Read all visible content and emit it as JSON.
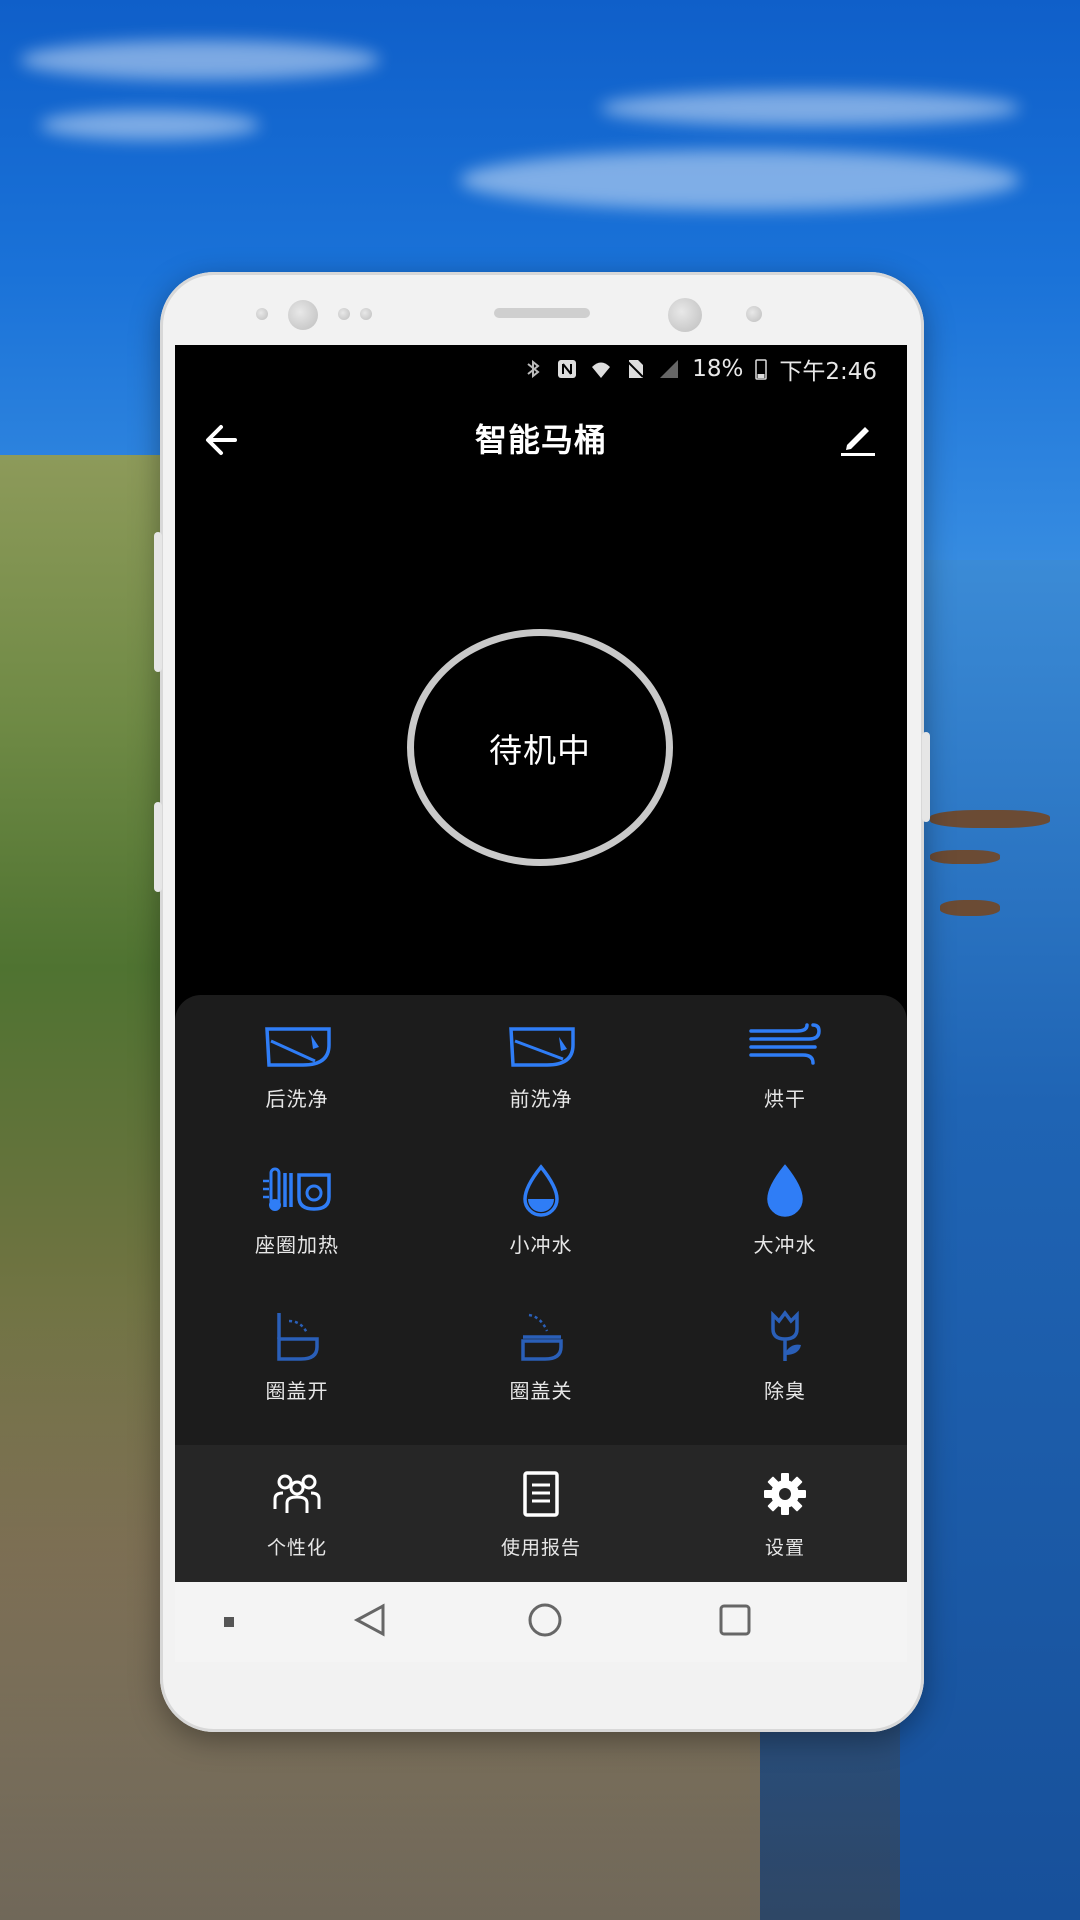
{
  "statusbar": {
    "battery": "18%",
    "time": "下午2:46"
  },
  "appbar": {
    "title": "智能马桶"
  },
  "device_status": {
    "text": "待机中"
  },
  "controls": [
    {
      "label": "后洗净",
      "icon": "rear-wash-icon"
    },
    {
      "label": "前洗净",
      "icon": "front-wash-icon"
    },
    {
      "label": "烘干",
      "icon": "dry-wind-icon"
    },
    {
      "label": "座圈加热",
      "icon": "seat-heating-icon"
    },
    {
      "label": "小冲水",
      "icon": "small-flush-icon"
    },
    {
      "label": "大冲水",
      "icon": "big-flush-icon"
    },
    {
      "label": "圈盖开",
      "icon": "lid-open-icon"
    },
    {
      "label": "圈盖关",
      "icon": "lid-close-icon"
    },
    {
      "label": "除臭",
      "icon": "deodorize-icon"
    }
  ],
  "bottom_nav": [
    {
      "label": "个性化",
      "icon": "users-icon"
    },
    {
      "label": "使用报告",
      "icon": "report-icon"
    },
    {
      "label": "设置",
      "icon": "gear-icon"
    }
  ],
  "colors": {
    "accent": "#2f7df6",
    "panel": "#1c1c1c",
    "nav": "#262626"
  }
}
